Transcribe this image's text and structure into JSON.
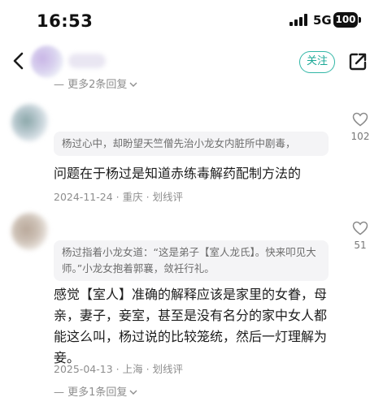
{
  "status_bar": {
    "time": "16:53",
    "network": "5G",
    "battery": "100"
  },
  "nav": {
    "follow_label": "关注",
    "accent_color": "#31b6a6"
  },
  "comments": [
    {
      "more_replies_top": "更多2条回复",
      "quote": "杨过心中，却盼望天竺僧先治小龙女内脏所中剧毒，",
      "text": "问题在于杨过是知道赤练毒解药配制方法的",
      "date": "2024-11-24",
      "location": "重庆",
      "action": "划线评",
      "likes": "102"
    },
    {
      "quote": "杨过指着小龙女道：“这是弟子【室人龙氏】。快来叩见大师。”小龙女抱着郭襄，敛衽行礼。",
      "text": "感觉【室人】准确的解释应该是家里的女眷，母亲，妻子，妾室，甚至是没有名分的家中女人都能这么叫，杨过说的比较笼统，然后一灯理解为妾。",
      "date": "2025-04-13",
      "location": "上海",
      "action": "划线评",
      "likes": "51",
      "more_replies": "更多1条回复"
    }
  ]
}
